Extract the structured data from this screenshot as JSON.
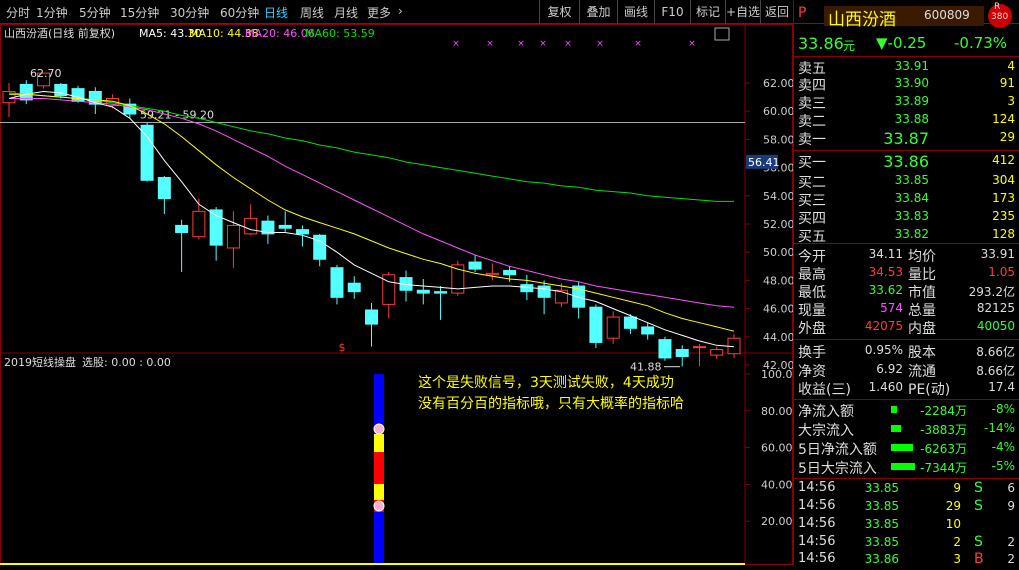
{
  "toolbar": {
    "periods": [
      "分时",
      "1分钟",
      "5分钟",
      "15分钟",
      "30分钟",
      "60分钟",
      "日线",
      "周线",
      "月线",
      "更多"
    ],
    "active": "日线",
    "more_arrow": "›",
    "right": [
      "复权",
      "叠加",
      "画线",
      "F10",
      "标记",
      "+自选",
      "返回"
    ]
  },
  "header": {
    "title": "山西汾酒(日线 前复权)",
    "ma5": "MA5: 43.30",
    "ma10": "MA10: 44.38",
    "ma20": "MA20: 46.06",
    "ma60": "MA60: 53.59",
    "colors": {
      "ma5": "#ffffff",
      "ma10": "#ffff00",
      "ma20": "#ff50ff",
      "ma60": "#00e000"
    }
  },
  "price_axis": [
    "62.00",
    "60.00",
    "58.00",
    "56.00",
    "54.00",
    "52.00",
    "50.00",
    "48.00",
    "46.00",
    "44.00",
    "42.00"
  ],
  "current_price_tag": "56.41",
  "annotations": {
    "high_label": "62.70",
    "resistance_label": "59.21 - 59.20",
    "low_label": "41.88",
    "signal_mark": "$"
  },
  "candles": [
    {
      "o": 60.6,
      "c": 61.4,
      "h": 62.0,
      "l": 59.6
    },
    {
      "o": 61.9,
      "c": 60.8,
      "h": 62.2,
      "l": 60.5
    },
    {
      "o": 61.8,
      "c": 62.7,
      "h": 62.7,
      "l": 61.6
    },
    {
      "o": 61.9,
      "c": 61.1,
      "h": 62.0,
      "l": 60.9
    },
    {
      "o": 61.6,
      "c": 60.7,
      "h": 61.8,
      "l": 60.6
    },
    {
      "o": 61.4,
      "c": 60.5,
      "h": 61.7,
      "l": 59.8
    },
    {
      "o": 60.4,
      "c": 60.9,
      "h": 61.2,
      "l": 60.2
    },
    {
      "o": 60.5,
      "c": 59.8,
      "h": 60.9,
      "l": 59.5
    },
    {
      "o": 59.0,
      "c": 55.1,
      "h": 59.2,
      "l": 55.0
    },
    {
      "o": 55.3,
      "c": 53.8,
      "h": 55.4,
      "l": 52.7
    },
    {
      "o": 51.9,
      "c": 51.4,
      "h": 52.3,
      "l": 48.6
    },
    {
      "o": 51.1,
      "c": 52.9,
      "h": 53.8,
      "l": 50.9
    },
    {
      "o": 53.0,
      "c": 50.5,
      "h": 53.2,
      "l": 49.4
    },
    {
      "o": 50.3,
      "c": 51.9,
      "h": 52.9,
      "l": 48.9
    },
    {
      "o": 51.3,
      "c": 52.4,
      "h": 53.4,
      "l": 51.2
    },
    {
      "o": 52.2,
      "c": 51.3,
      "h": 52.6,
      "l": 50.6
    },
    {
      "o": 51.9,
      "c": 51.7,
      "h": 52.9,
      "l": 51.4
    },
    {
      "o": 51.6,
      "c": 51.3,
      "h": 51.9,
      "l": 50.4
    },
    {
      "o": 51.2,
      "c": 49.5,
      "h": 51.3,
      "l": 49.0
    },
    {
      "o": 48.9,
      "c": 46.8,
      "h": 49.1,
      "l": 46.3
    },
    {
      "o": 47.8,
      "c": 47.2,
      "h": 48.3,
      "l": 46.7
    },
    {
      "o": 45.9,
      "c": 44.9,
      "h": 46.4,
      "l": 43.3
    },
    {
      "o": 46.3,
      "c": 48.4,
      "h": 48.6,
      "l": 45.3
    },
    {
      "o": 48.2,
      "c": 47.3,
      "h": 48.7,
      "l": 46.5
    },
    {
      "o": 47.3,
      "c": 47.1,
      "h": 48.1,
      "l": 46.3
    },
    {
      "o": 47.2,
      "c": 47.1,
      "h": 47.6,
      "l": 45.2
    },
    {
      "o": 47.1,
      "c": 49.1,
      "h": 49.4,
      "l": 46.9
    },
    {
      "o": 49.3,
      "c": 48.8,
      "h": 49.8,
      "l": 48.6
    },
    {
      "o": 48.4,
      "c": 48.5,
      "h": 49.2,
      "l": 48.0
    },
    {
      "o": 48.7,
      "c": 48.4,
      "h": 49.0,
      "l": 47.9
    },
    {
      "o": 47.7,
      "c": 47.2,
      "h": 48.4,
      "l": 46.6
    },
    {
      "o": 47.6,
      "c": 46.8,
      "h": 48.0,
      "l": 45.6
    },
    {
      "o": 46.4,
      "c": 47.3,
      "h": 47.8,
      "l": 46.1
    },
    {
      "o": 47.6,
      "c": 46.1,
      "h": 47.9,
      "l": 45.3
    },
    {
      "o": 46.1,
      "c": 43.6,
      "h": 46.3,
      "l": 43.2
    },
    {
      "o": 43.9,
      "c": 45.4,
      "h": 45.8,
      "l": 43.5
    },
    {
      "o": 45.4,
      "c": 44.6,
      "h": 45.6,
      "l": 44.2
    },
    {
      "o": 44.7,
      "c": 44.2,
      "h": 45.0,
      "l": 43.8
    },
    {
      "o": 43.8,
      "c": 42.5,
      "h": 44.0,
      "l": 42.3
    },
    {
      "o": 43.1,
      "c": 42.6,
      "h": 43.4,
      "l": 41.9
    },
    {
      "o": 43.3,
      "c": 43.3,
      "h": 43.5,
      "l": 41.9
    },
    {
      "o": 42.7,
      "c": 43.1,
      "h": 43.3,
      "l": 42.4
    },
    {
      "o": 42.8,
      "c": 43.9,
      "h": 44.2,
      "l": 42.5
    }
  ],
  "ma_lines": {
    "ma5": [
      60.9,
      61.2,
      61.4,
      61.3,
      61.0,
      60.6,
      60.3,
      59.5,
      58.2,
      56.5,
      55.0,
      53.4,
      52.6,
      52.1,
      51.6,
      51.4,
      51.4,
      51.2,
      50.8,
      50.0,
      49.1,
      48.5,
      47.9,
      47.7,
      47.6,
      47.5,
      47.4,
      47.5,
      47.6,
      47.6,
      47.5,
      47.4,
      47.2,
      46.8,
      46.5,
      46.0,
      45.5,
      45.0,
      44.5,
      44.1,
      43.7,
      43.4,
      43.3
    ],
    "ma10": [
      61.2,
      61.2,
      61.1,
      61.0,
      60.9,
      60.8,
      60.7,
      60.4,
      59.8,
      59.1,
      58.2,
      57.2,
      56.2,
      55.3,
      54.5,
      53.7,
      53.0,
      52.5,
      52.1,
      51.7,
      51.3,
      50.8,
      50.3,
      49.9,
      49.5,
      49.2,
      48.8,
      48.5,
      48.3,
      48.1,
      48.0,
      47.8,
      47.6,
      47.4,
      47.1,
      46.8,
      46.5,
      46.2,
      45.7,
      45.3,
      45.0,
      44.7,
      44.4
    ],
    "ma20": [
      60.9,
      60.9,
      60.9,
      60.8,
      60.7,
      60.6,
      60.5,
      60.3,
      60.1,
      59.8,
      59.5,
      59.1,
      58.6,
      58.0,
      57.4,
      56.8,
      56.1,
      55.5,
      54.9,
      54.3,
      53.7,
      53.1,
      52.5,
      51.9,
      51.3,
      50.8,
      50.3,
      49.8,
      49.4,
      49.0,
      48.7,
      48.4,
      48.1,
      47.9,
      47.6,
      47.4,
      47.2,
      47.0,
      46.8,
      46.6,
      46.4,
      46.2,
      46.1
    ],
    "ma60": [
      61.3,
      61.2,
      61.1,
      61.0,
      60.9,
      60.8,
      60.6,
      60.4,
      60.2,
      60.0,
      59.7,
      59.5,
      59.2,
      58.9,
      58.6,
      58.4,
      58.1,
      57.9,
      57.6,
      57.4,
      57.1,
      56.9,
      56.7,
      56.4,
      56.2,
      56.0,
      55.8,
      55.6,
      55.4,
      55.2,
      55.0,
      54.9,
      54.7,
      54.6,
      54.4,
      54.3,
      54.2,
      54.0,
      53.9,
      53.8,
      53.7,
      53.6,
      53.6
    ]
  },
  "sub": {
    "title": "2019短线操盘",
    "pick": "选股: 0.00 : 0.00",
    "axis": [
      "100.0",
      "80.00",
      "60.00",
      "40.00",
      "20.00"
    ],
    "comment1": "这个是失败信号，3天测试失败，4天成功",
    "comment2": "没有百分百的指标哦，只有大概率的指标哈"
  },
  "info": {
    "p": "P",
    "name": "山西汾酒",
    "code": "600809",
    "badge_r": "R",
    "badge_num": "380",
    "price": "33.86",
    "unit": "元",
    "change": "▼-0.25",
    "pct": "-0.73%",
    "asks": [
      [
        "卖五",
        "33.91",
        "4"
      ],
      [
        "卖四",
        "33.90",
        "91"
      ],
      [
        "卖三",
        "33.89",
        "3"
      ],
      [
        "卖二",
        "33.88",
        "124"
      ],
      [
        "卖一",
        "33.87",
        "29"
      ]
    ],
    "bids": [
      [
        "买一",
        "33.86",
        "412"
      ],
      [
        "买二",
        "33.85",
        "304"
      ],
      [
        "买三",
        "33.84",
        "173"
      ],
      [
        "买四",
        "33.83",
        "235"
      ],
      [
        "买五",
        "33.82",
        "128"
      ]
    ],
    "stats": [
      [
        "今开",
        "34.11",
        "wht",
        "均价",
        "33.91",
        "wht"
      ],
      [
        "最高",
        "34.53",
        "red",
        "量比",
        "1.05",
        "red"
      ],
      [
        "最低",
        "33.62",
        "grn",
        "市值",
        "293.2亿",
        "wht"
      ],
      [
        "现量",
        "574",
        "mag",
        "总量",
        "82125",
        "wht"
      ],
      [
        "外盘",
        "42075",
        "red",
        "内盘",
        "40050",
        "grn"
      ]
    ],
    "stats2": [
      [
        "换手",
        "0.95%",
        "股本",
        "8.66亿"
      ],
      [
        "净资",
        "6.92",
        "流通",
        "8.66亿"
      ],
      [
        "收益(三)",
        "1.460",
        "PE(动)",
        "17.4"
      ]
    ],
    "flows": [
      [
        "净流入额",
        "-2284万",
        "-8%",
        6
      ],
      [
        "大宗流入",
        "-3883万",
        "-14%",
        10
      ],
      [
        "5日净流入额",
        "-6263万",
        "-4%",
        22
      ],
      [
        "5日大宗流入",
        "-7344万",
        "-5%",
        24
      ]
    ],
    "ticks": [
      [
        "14:56",
        "33.85",
        "9",
        "S",
        "6"
      ],
      [
        "14:56",
        "33.85",
        "29",
        "S",
        "9"
      ],
      [
        "14:56",
        "33.85",
        "10",
        "",
        ""
      ],
      [
        "14:56",
        "33.85",
        "2",
        "S",
        "2"
      ],
      [
        "14:56",
        "33.86",
        "3",
        "B",
        "2"
      ]
    ]
  }
}
